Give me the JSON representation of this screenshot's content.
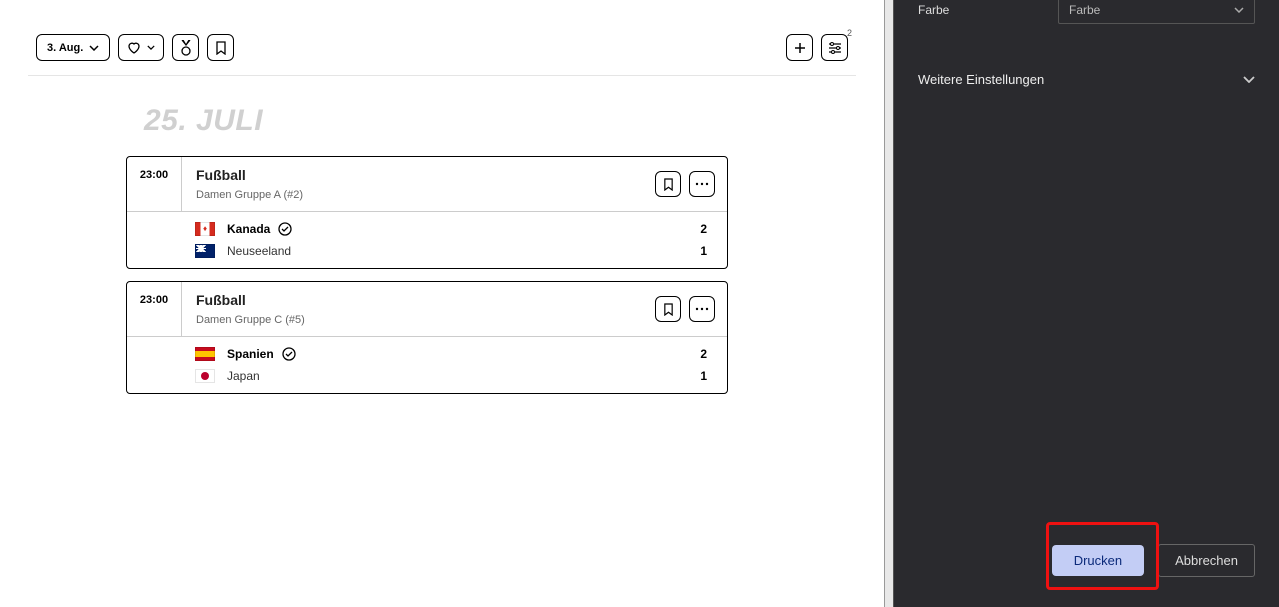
{
  "toolbar": {
    "date_label": "3. Aug.",
    "filter_badge": "2"
  },
  "date_heading": "25. JULI",
  "events": [
    {
      "time": "23:00",
      "sport": "Fußball",
      "group": "Damen Gruppe A (#2)",
      "teams": [
        {
          "name": "Kanada",
          "score": "2",
          "flag": "can",
          "winner": true
        },
        {
          "name": "Neuseeland",
          "score": "1",
          "flag": "nzl",
          "winner": false
        }
      ]
    },
    {
      "time": "23:00",
      "sport": "Fußball",
      "group": "Damen Gruppe C (#5)",
      "teams": [
        {
          "name": "Spanien",
          "score": "2",
          "flag": "esp",
          "winner": true
        },
        {
          "name": "Japan",
          "score": "1",
          "flag": "jpn",
          "winner": false
        }
      ]
    }
  ],
  "panel": {
    "color_label": "Farbe",
    "color_value": "Farbe",
    "more_settings": "Weitere Einstellungen",
    "print_label": "Drucken",
    "cancel_label": "Abbrechen"
  }
}
